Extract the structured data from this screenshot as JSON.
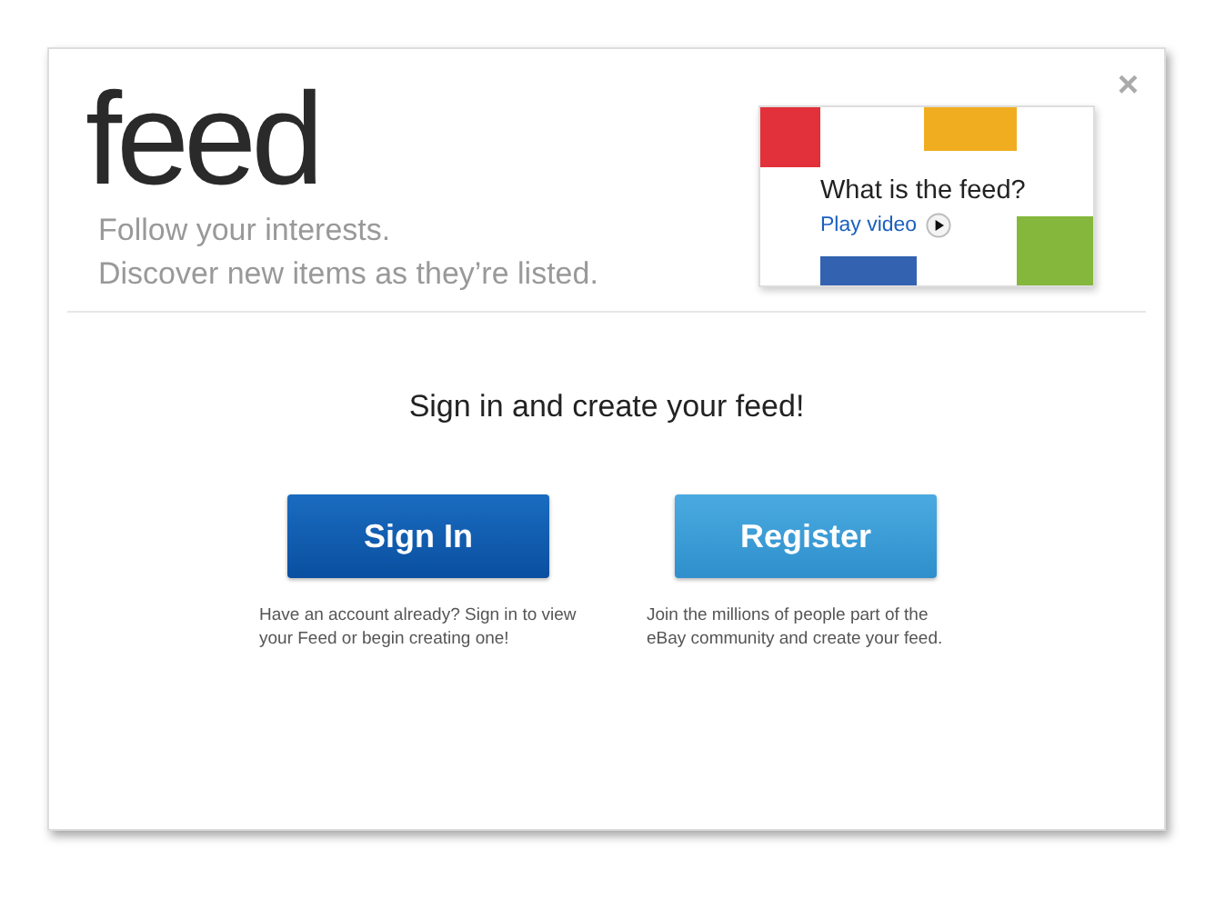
{
  "logo": "feed",
  "taglines": [
    "Follow your interests.",
    "Discover new items as they’re listed."
  ],
  "close": "×",
  "video_card": {
    "title": "What is the feed?",
    "link": "Play video"
  },
  "heading": "Sign in and create your feed!",
  "actions": [
    {
      "label": "Sign In",
      "kind": "primary",
      "description": "Have an account already?  Sign in to view your Feed or begin creating one!"
    },
    {
      "label": "Register",
      "kind": "secondary",
      "description": "Join the millions of people part of the eBay community and create your feed."
    }
  ]
}
